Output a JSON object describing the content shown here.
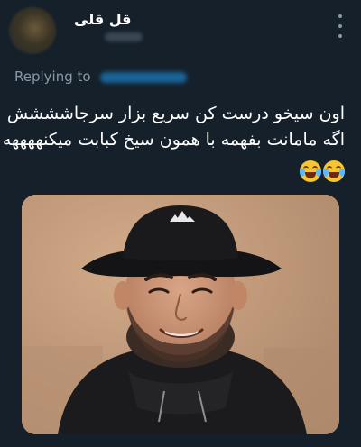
{
  "tweet": {
    "display_name": "قل قلی",
    "replying_label": "Replying to",
    "text_lines": [
      "اون سیخو درست کن سریع بزار سرجاشششش",
      "اگه مامانت بفهمه با همون سیخ کبابت میکنههههه"
    ],
    "emojis": [
      "face-with-tears-of-joy-icon",
      "face-with-tears-of-joy-icon"
    ]
  },
  "photo": {
    "hat_logo": "adidas"
  },
  "colors": {
    "background": "#15202b",
    "secondary_text": "#8b98a5",
    "link": "#1d9bf0"
  }
}
